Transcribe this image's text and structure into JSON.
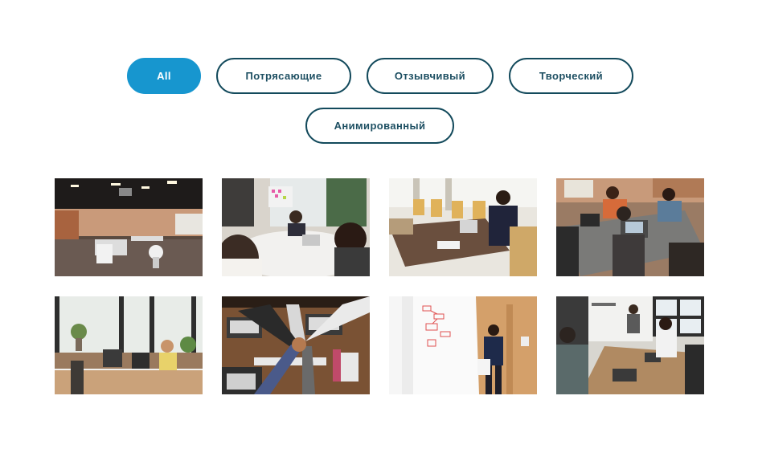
{
  "filters": [
    {
      "label": "All",
      "active": true
    },
    {
      "label": "Потрясающие",
      "active": false
    },
    {
      "label": "Отзывчивый",
      "active": false
    },
    {
      "label": "Творческий",
      "active": false
    },
    {
      "label": "Анимированный",
      "active": false
    }
  ],
  "gallery": {
    "items": [
      {
        "icon": "open-office-photo"
      },
      {
        "icon": "meeting-table-photo"
      },
      {
        "icon": "conference-room-photo"
      },
      {
        "icon": "team-laptops-photo"
      },
      {
        "icon": "office-desk-photo"
      },
      {
        "icon": "team-fist-bump-photo"
      },
      {
        "icon": "whiteboard-presentation-photo"
      },
      {
        "icon": "team-meeting-presentation-photo"
      }
    ]
  },
  "colors": {
    "accent": "#1796cf",
    "outline": "#134a5c"
  }
}
